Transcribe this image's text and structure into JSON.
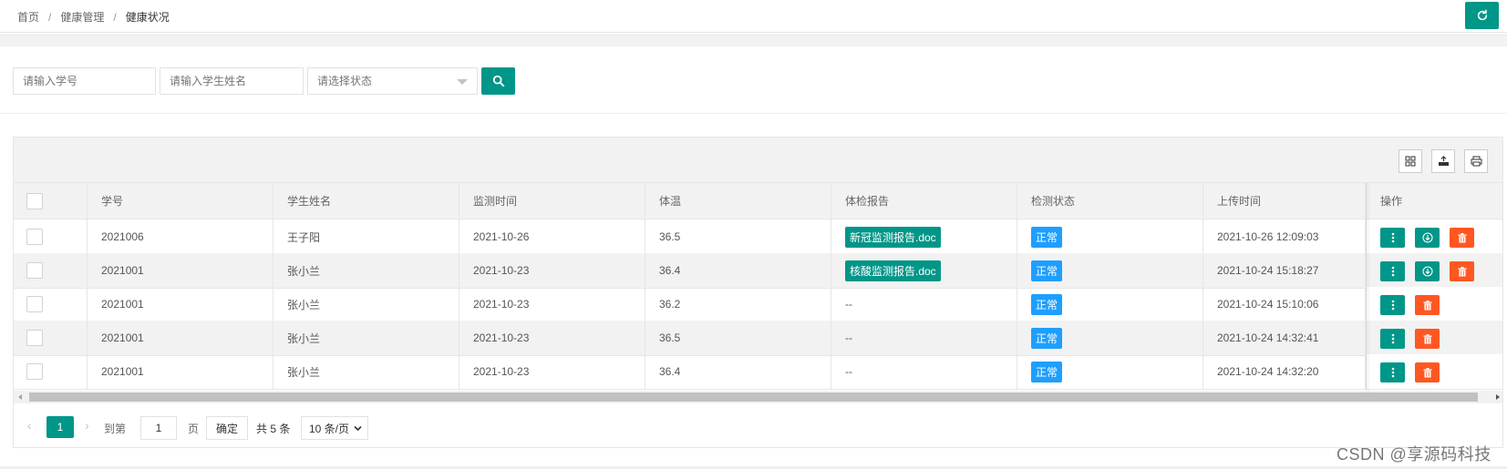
{
  "breadcrumb": {
    "items": [
      "首页",
      "健康管理",
      "健康状况"
    ],
    "separator": "/"
  },
  "colors": {
    "primary": "#009688",
    "danger": "#ff5722",
    "info": "#1e9fff"
  },
  "search": {
    "student_id_placeholder": "请输入学号",
    "student_name_placeholder": "请输入学生姓名",
    "status_placeholder": "请选择状态"
  },
  "icons": {
    "refresh": "refresh-icon",
    "search": "search-icon",
    "columns": "grid-icon",
    "export": "export-icon",
    "print": "print-icon"
  },
  "table": {
    "headers": [
      "学号",
      "学生姓名",
      "监测时间",
      "体温",
      "体检报告",
      "检测状态",
      "上传时间",
      "操作"
    ],
    "rows": [
      {
        "student_id": "2021006",
        "name": "王子阳",
        "monitor_time": "2021-10-26",
        "temperature": "36.5",
        "report": "新冠监测报告.doc",
        "status": "正常",
        "upload_time": "2021-10-26 12:09:03",
        "has_download": true
      },
      {
        "student_id": "2021001",
        "name": "张小兰",
        "monitor_time": "2021-10-23",
        "temperature": "36.4",
        "report": "核酸监测报告.doc",
        "status": "正常",
        "upload_time": "2021-10-24 15:18:27",
        "has_download": true
      },
      {
        "student_id": "2021001",
        "name": "张小兰",
        "monitor_time": "2021-10-23",
        "temperature": "36.2",
        "report": "--",
        "status": "正常",
        "upload_time": "2021-10-24 15:10:06",
        "has_download": false
      },
      {
        "student_id": "2021001",
        "name": "张小兰",
        "monitor_time": "2021-10-23",
        "temperature": "36.5",
        "report": "--",
        "status": "正常",
        "upload_time": "2021-10-24 14:32:41",
        "has_download": false
      },
      {
        "student_id": "2021001",
        "name": "张小兰",
        "monitor_time": "2021-10-23",
        "temperature": "36.4",
        "report": "--",
        "status": "正常",
        "upload_time": "2021-10-24 14:32:20",
        "has_download": false
      }
    ]
  },
  "pagination": {
    "current_page": "1",
    "goto_label": "到第",
    "goto_value": "1",
    "page_unit": "页",
    "confirm_label": "确定",
    "total_label": "共 5 条",
    "page_size_label": "10 条/页"
  },
  "watermark": "CSDN @享源码科技"
}
